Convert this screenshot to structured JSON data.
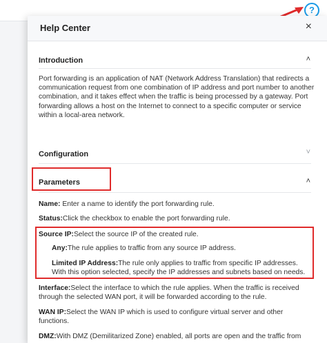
{
  "topbar": {
    "help_icon": "question-circle-icon",
    "accent_color": "#1a9ae6"
  },
  "annotation": {
    "color": "#e02b2b"
  },
  "help_center": {
    "title": "Help Center",
    "close_symbol": "×",
    "sections": {
      "introduction": {
        "title": "Introduction",
        "expanded": true,
        "text": "Port forwarding is an application of NAT (Network Address Translation) that redirects a communication request from one combination of IP address and port number to another combination, and it takes effect when the traffic is being processed by a gateway. Port forwarding allows a host on the Internet to connect to a specific computer or service within a local-area network."
      },
      "configuration": {
        "title": "Configuration",
        "expanded": false
      },
      "parameters": {
        "title": "Parameters",
        "expanded": true,
        "name": {
          "term": "Name:",
          "desc": " Enter a name to identify the port forwarding rule."
        },
        "status": {
          "term": "Status:",
          "desc": "Click the checkbox to enable the port forwarding rule."
        },
        "source_ip": {
          "term": "Source IP:",
          "desc": "Select the source IP of the created rule.",
          "any": {
            "term": "Any:",
            "desc": "The rule applies to traffic from any source IP address."
          },
          "limited": {
            "term": "Limited IP Address:",
            "desc": "The rule only applies to traffic from specific IP addresses.",
            "desc2": "With this option selected, specify the IP addresses and subnets based on needs."
          }
        },
        "interface": {
          "term": "Interface:",
          "desc": "Select the interface to which the rule applies. When the traffic is received",
          "desc2": "through the selected WAN port, it will be forwarded according to the rule."
        },
        "wan_ip": {
          "term": "WAN IP:",
          "desc": "Select the WAN IP which is used to configure virtual server and other",
          "desc2": "functions."
        },
        "dmz": {
          "term": "DMZ:",
          "desc": "With DMZ (Demilitarized Zone) enabled, all ports are open and the traffic from"
        }
      }
    }
  }
}
